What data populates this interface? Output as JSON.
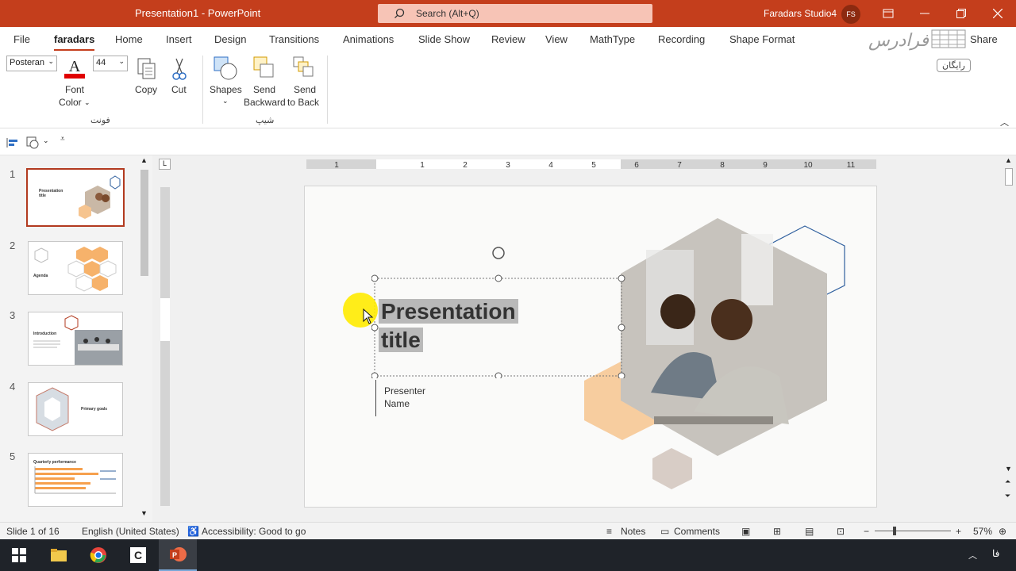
{
  "titlebar": {
    "doc_title": "Presentation1 - PowerPoint",
    "search_placeholder": "Search (Alt+Q)",
    "account_name": "Faradars Studio4",
    "avatar_initials": "FS"
  },
  "tabs": [
    "File",
    "faradars",
    "Home",
    "Insert",
    "Design",
    "Transitions",
    "Animations",
    "Slide Show",
    "Review",
    "View",
    "MathType",
    "Recording",
    "Shape Format"
  ],
  "active_tab": "faradars",
  "share_label": "Share",
  "ribbon": {
    "font_name": "Posteran",
    "font_size": "44",
    "font_color_label_1": "Font",
    "font_color_label_2": "Color",
    "font_color_value": "#e00000",
    "copy_label": "Copy",
    "cut_label": "Cut",
    "group_font_label": "فونت",
    "shapes_label": "Shapes",
    "send_backward_1": "Send",
    "send_backward_2": "Backward",
    "send_back_1": "Send",
    "send_back_2": "to Back",
    "group_shape_label": "شیپ"
  },
  "watermark": {
    "brand": "فرادرس",
    "tag": "رایگان"
  },
  "thumbnails": [
    {
      "num": "1",
      "text": "Presentation title"
    },
    {
      "num": "2",
      "text": "Agenda"
    },
    {
      "num": "3",
      "text": "Introduction"
    },
    {
      "num": "4",
      "text": "Primary goals"
    },
    {
      "num": "5",
      "text": "Quarterly performance"
    }
  ],
  "slide": {
    "title_line1": "Presentation",
    "title_line2": "title",
    "presenter_line1": "Presenter",
    "presenter_line2": "Name"
  },
  "ruler": {
    "h_numbers": [
      "1",
      "1",
      "2",
      "3",
      "4",
      "5",
      "6",
      "7",
      "8",
      "9",
      "10",
      "11"
    ]
  },
  "statusbar": {
    "slide_info": "Slide 1 of 16",
    "language": "English (United States)",
    "accessibility": "Accessibility: Good to go",
    "notes": "Notes",
    "comments": "Comments",
    "zoom": "57%"
  },
  "taskbar": {
    "lang": "فا"
  },
  "colors": {
    "accent": "#c43e1c",
    "hex_orange": "#f6c48f",
    "hex_blue": "#2f5f9e",
    "selection_gray": "#b9b9b9"
  }
}
